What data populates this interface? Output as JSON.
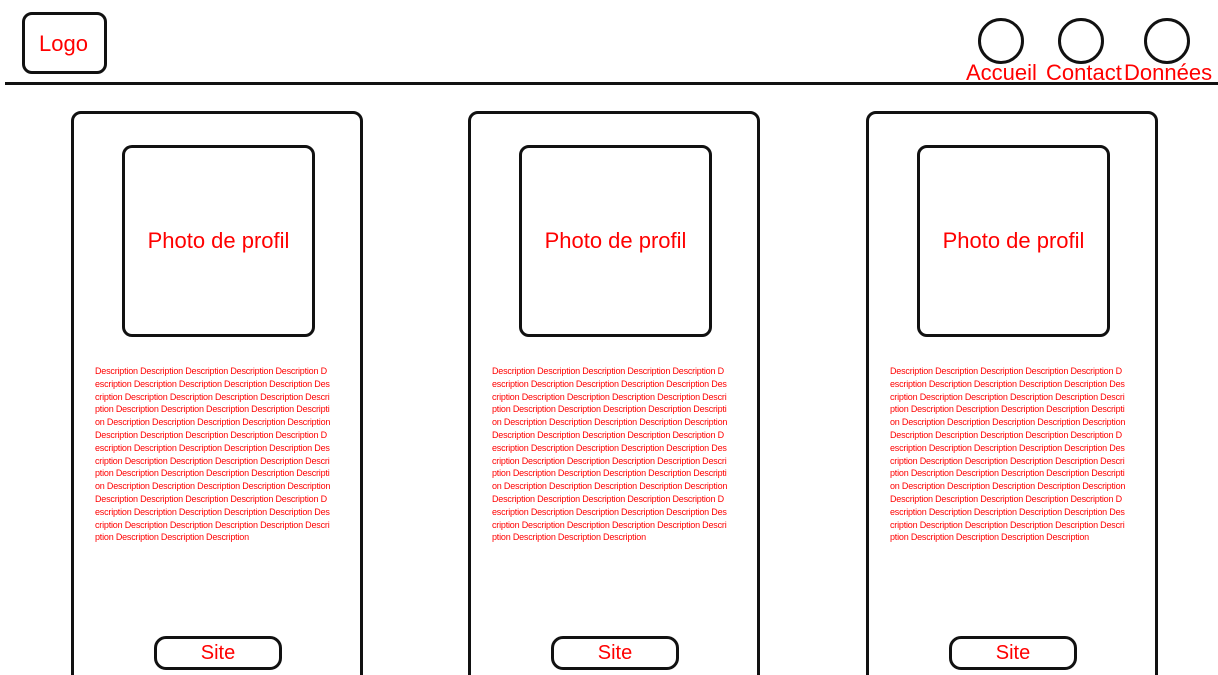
{
  "header": {
    "logo_label": "Logo",
    "nav": [
      {
        "label": "Accueil"
      },
      {
        "label": "Contact"
      },
      {
        "label": "Données"
      }
    ]
  },
  "cards": [
    {
      "photo_label": "Photo de profil",
      "description": "Description Description Description Description Description Description Description Description Description Description Description Description Description Description Description Description Description Description Description Description Description Description Description Description Description Description Description Description Description Description Description Description Description Description Description Description Description Description Description Description Description Description Description Description Description Description Description Description Description Description Description Description Description Description Description Description Description Description Description Description Description Description Description Description Description Description Description Description Description Description Description",
      "site_label": "Site"
    },
    {
      "photo_label": "Photo de profil",
      "description": "Description Description Description Description Description Description Description Description Description Description Description Description Description Description Description Description Description Description Description Description Description Description Description Description Description Description Description Description Description Description Description Description Description Description Description Description Description Description Description Description Description Description Description Description Description Description Description Description Description Description Description Description Description Description Description Description Description Description Description Description Description Description Description Description Description Description Description Description Description Description Description",
      "site_label": "Site"
    },
    {
      "photo_label": "Photo de profil",
      "description": "Description Description Description Description Description Description Description Description Description Description Description Description Description Description Description Description Description Description Description Description Description Description Description Description Description Description Description Description Description Description Description Description Description Description Description Description Description Description Description Description Description Description Description Description Description Description Description Description Description Description Description Description Description Description Description Description Description Description Description Description Description Description Description Description Description Description Description Description Description Description Description Description",
      "site_label": "Site"
    }
  ]
}
